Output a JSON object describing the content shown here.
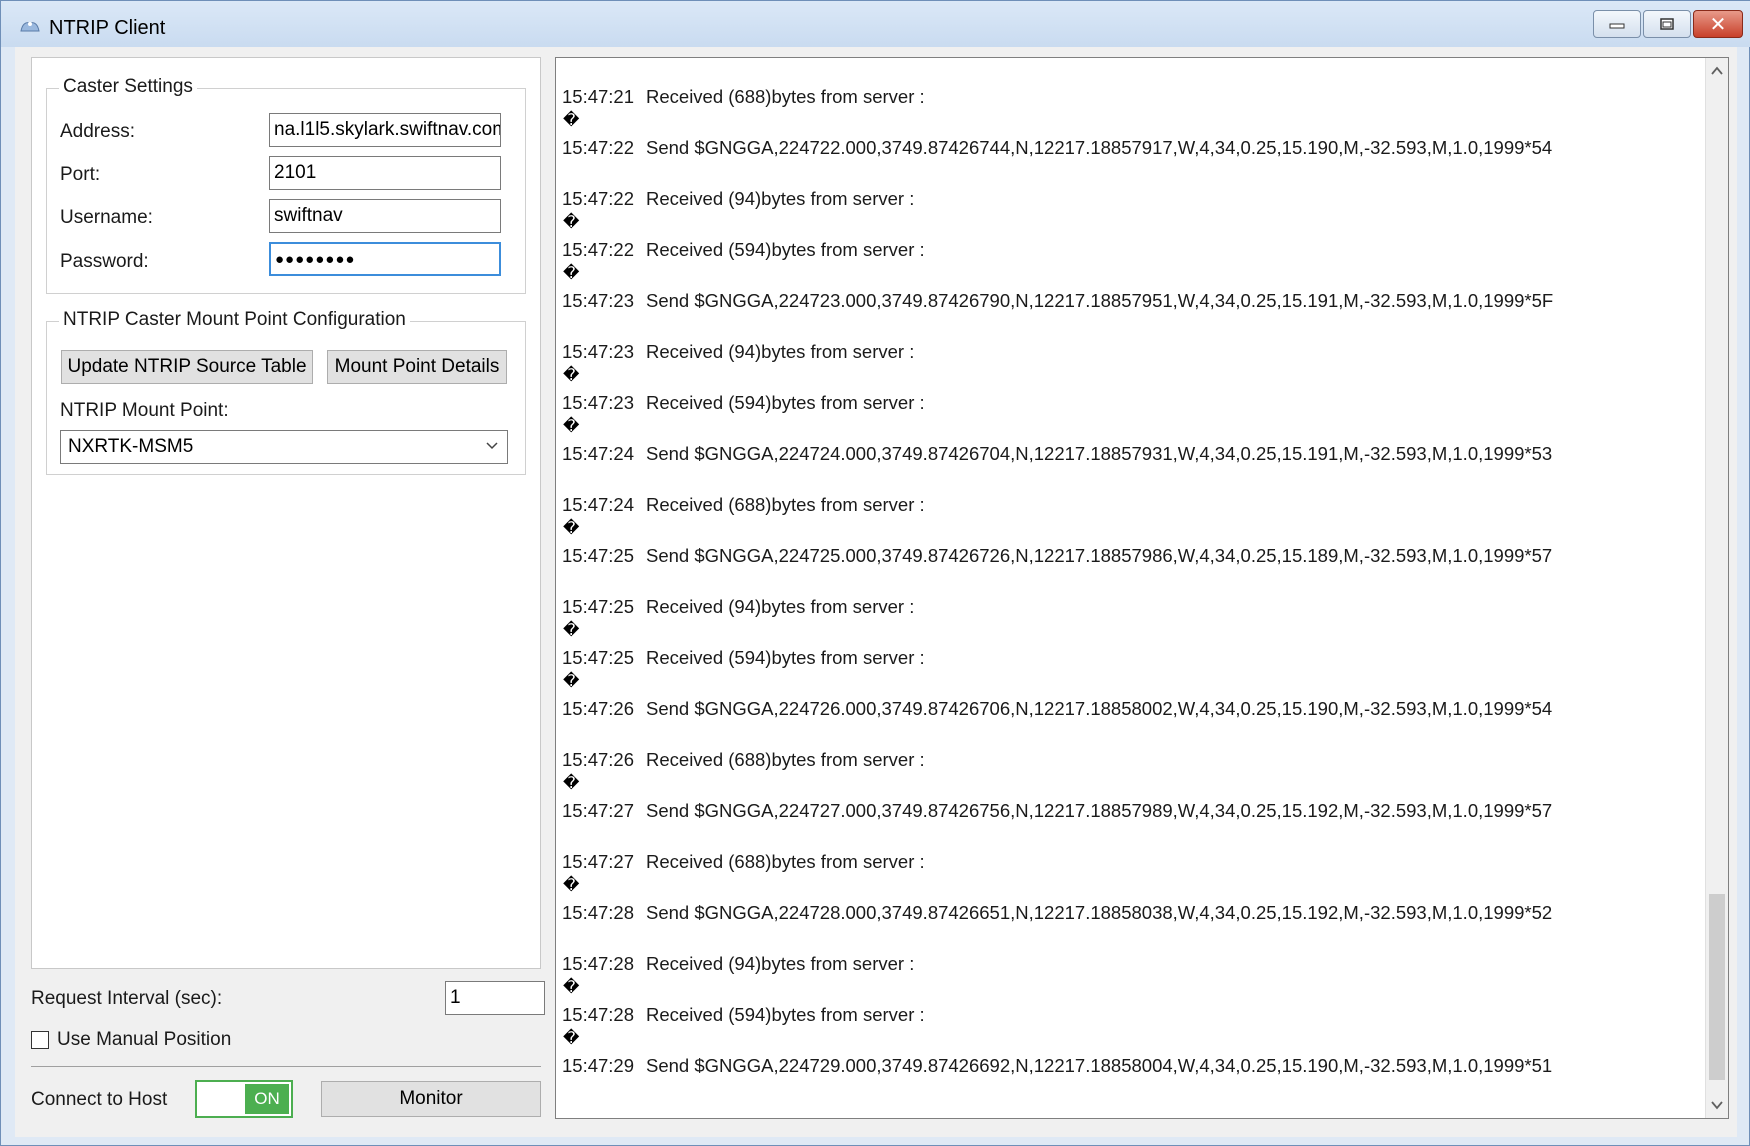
{
  "window": {
    "title": "NTRIP Client",
    "minimize_label": "",
    "maximize_label": "",
    "close_label": "✕"
  },
  "caster_settings": {
    "legend": "Caster Settings",
    "address_label": "Address:",
    "address_value": "na.l1l5.skylark.swiftnav.com",
    "port_label": "Port:",
    "port_value": "2101",
    "username_label": "Username:",
    "username_value": "swiftnav",
    "password_label": "Password:",
    "password_value": "●●●●●●●●"
  },
  "mount_point_config": {
    "legend": "NTRIP Caster Mount Point Configuration",
    "update_button": "Update NTRIP Source Table",
    "details_button": "Mount Point Details",
    "mount_point_label": "NTRIP Mount Point:",
    "mount_point_value": "NXRTK-MSM5"
  },
  "bottom": {
    "request_interval_label": "Request Interval (sec):",
    "request_interval_value": "1",
    "manual_position_label": "Use Manual Position",
    "manual_position_checked": false,
    "connect_label": "Connect to Host",
    "toggle_state": "ON",
    "monitor_button": "Monitor"
  },
  "log": {
    "unknown_glyph": "�",
    "lines": [
      {
        "time": "15:47:21",
        "text": "Received (688)bytes from server :",
        "glyph_after": true
      },
      {
        "time": "15:47:22",
        "text": "Send $GNGGA,224722.000,3749.87426744,N,12217.18857917,W,4,34,0.25,15.190,M,-32.593,M,1.0,1999*54",
        "glyph_after": false
      },
      {
        "time": "15:47:22",
        "text": "Received (94)bytes from server :",
        "glyph_after": true
      },
      {
        "time": "15:47:22",
        "text": "Received (594)bytes from server :",
        "glyph_after": true
      },
      {
        "time": "15:47:23",
        "text": "Send $GNGGA,224723.000,3749.87426790,N,12217.18857951,W,4,34,0.25,15.191,M,-32.593,M,1.0,1999*5F",
        "glyph_after": false
      },
      {
        "time": "15:47:23",
        "text": "Received (94)bytes from server :",
        "glyph_after": true
      },
      {
        "time": "15:47:23",
        "text": "Received (594)bytes from server :",
        "glyph_after": true
      },
      {
        "time": "15:47:24",
        "text": "Send $GNGGA,224724.000,3749.87426704,N,12217.18857931,W,4,34,0.25,15.191,M,-32.593,M,1.0,1999*53",
        "glyph_after": false
      },
      {
        "time": "15:47:24",
        "text": "Received (688)bytes from server :",
        "glyph_after": true
      },
      {
        "time": "15:47:25",
        "text": "Send $GNGGA,224725.000,3749.87426726,N,12217.18857986,W,4,34,0.25,15.189,M,-32.593,M,1.0,1999*57",
        "glyph_after": false
      },
      {
        "time": "15:47:25",
        "text": "Received (94)bytes from server :",
        "glyph_after": true
      },
      {
        "time": "15:47:25",
        "text": "Received (594)bytes from server :",
        "glyph_after": true
      },
      {
        "time": "15:47:26",
        "text": "Send $GNGGA,224726.000,3749.87426706,N,12217.18858002,W,4,34,0.25,15.190,M,-32.593,M,1.0,1999*54",
        "glyph_after": false
      },
      {
        "time": "15:47:26",
        "text": "Received (688)bytes from server :",
        "glyph_after": true
      },
      {
        "time": "15:47:27",
        "text": "Send $GNGGA,224727.000,3749.87426756,N,12217.18857989,W,4,34,0.25,15.192,M,-32.593,M,1.0,1999*57",
        "glyph_after": false
      },
      {
        "time": "15:47:27",
        "text": "Received (688)bytes from server :",
        "glyph_after": true
      },
      {
        "time": "15:47:28",
        "text": "Send $GNGGA,224728.000,3749.87426651,N,12217.18858038,W,4,34,0.25,15.192,M,-32.593,M,1.0,1999*52",
        "glyph_after": false
      },
      {
        "time": "15:47:28",
        "text": "Received (94)bytes from server :",
        "glyph_after": true
      },
      {
        "time": "15:47:28",
        "text": "Received (594)bytes from server :",
        "glyph_after": true
      },
      {
        "time": "15:47:29",
        "text": "Send $GNGGA,224729.000,3749.87426692,N,12217.18858004,W,4,34,0.25,15.190,M,-32.593,M,1.0,1999*51",
        "glyph_after": false
      }
    ]
  },
  "colors": {
    "toggle_on": "#4caf50",
    "focus_border": "#3c8ddb",
    "close_button": "#c8402a"
  }
}
